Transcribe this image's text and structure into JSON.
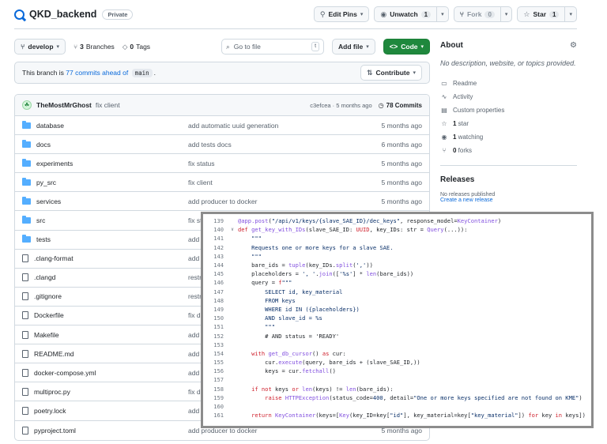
{
  "repo": {
    "name": "QKD_backend",
    "visibility": "Private",
    "actions": {
      "edit_pins": "Edit Pins",
      "unwatch": "Unwatch",
      "unwatch_count": "1",
      "fork": "Fork",
      "fork_count": "0",
      "star": "Star",
      "star_count": "1"
    }
  },
  "toolbar": {
    "branch": "develop",
    "branches_count": "3",
    "branches_label": "Branches",
    "tags_count": "0",
    "tags_label": "Tags",
    "search_placeholder": "Go to file",
    "search_kbd": "t",
    "add_file": "Add file",
    "code": "Code"
  },
  "ahead": {
    "prefix": "This branch is",
    "link": "77 commits ahead of",
    "base": "main",
    "suffix": ".",
    "contribute": "Contribute"
  },
  "last_commit": {
    "author": "TheMostMrGhost",
    "message": "fix client",
    "meta": "c3efcea · 5 months ago",
    "commits": "78 Commits"
  },
  "files": [
    {
      "name": "database",
      "type": "dir",
      "message": "add automatic uuid generation",
      "date": "5 months ago"
    },
    {
      "name": "docs",
      "type": "dir",
      "message": "add tests docs",
      "date": "6 months ago"
    },
    {
      "name": "experiments",
      "type": "dir",
      "message": "fix status",
      "date": "5 months ago"
    },
    {
      "name": "py_src",
      "type": "dir",
      "message": "fix client",
      "date": "5 months ago"
    },
    {
      "name": "services",
      "type": "dir",
      "message": "add producer to docker",
      "date": "5 months ago"
    },
    {
      "name": "src",
      "type": "dir",
      "message": "fix st",
      "date": ""
    },
    {
      "name": "tests",
      "type": "dir",
      "message": "add t",
      "date": ""
    },
    {
      "name": ".clang-format",
      "type": "file",
      "message": "add a",
      "date": ""
    },
    {
      "name": ".clangd",
      "type": "file",
      "message": "restr",
      "date": ""
    },
    {
      "name": ".gitignore",
      "type": "file",
      "message": "restr",
      "date": ""
    },
    {
      "name": "Dockerfile",
      "type": "file",
      "message": "fix de",
      "date": ""
    },
    {
      "name": "Makefile",
      "type": "file",
      "message": "add p",
      "date": ""
    },
    {
      "name": "README.md",
      "type": "file",
      "message": "add p",
      "date": ""
    },
    {
      "name": "docker-compose.yml",
      "type": "file",
      "message": "add p",
      "date": ""
    },
    {
      "name": "multiproc.py",
      "type": "file",
      "message": "fix de",
      "date": ""
    },
    {
      "name": "poetry.lock",
      "type": "file",
      "message": "add p",
      "date": ""
    },
    {
      "name": "pyproject.toml",
      "type": "file",
      "message": "add producer to docker",
      "date": "5 months ago"
    }
  ],
  "about": {
    "title": "About",
    "description": "No description, website, or topics provided.",
    "items": [
      {
        "icon": "book-icon",
        "glyph": "▭",
        "label": "Readme",
        "bold": ""
      },
      {
        "icon": "pulse-icon",
        "glyph": "∿",
        "label": "Activity",
        "bold": ""
      },
      {
        "icon": "note-icon",
        "glyph": "▤",
        "label": "Custom properties",
        "bold": ""
      },
      {
        "icon": "star-icon",
        "glyph": "☆",
        "label": " star",
        "bold": "1"
      },
      {
        "icon": "eye-icon",
        "glyph": "◉",
        "label": " watching",
        "bold": "1"
      },
      {
        "icon": "fork-icon",
        "glyph": "⑂",
        "label": " forks",
        "bold": "0"
      }
    ]
  },
  "releases": {
    "title": "Releases",
    "none": "No releases published",
    "create": "Create a new release"
  },
  "code": {
    "lines": [
      {
        "n": "139",
        "fold": "",
        "html": "<span class='fn'>@app.post</span>(<span class='st'>\"/api/v1/keys/{slave_SAE_ID}/dec_keys\"</span>, response_model=<span class='fn'>KeyContainer</span>)"
      },
      {
        "n": "140",
        "fold": "∨",
        "html": "<span class='kw'>def</span> <span class='fn'>get_key_with_IDs</span>(slave_SAE_ID: <span class='kw'>UUID</span>, key_IDs: str = <span class='fn'>Query</span>(...)):"
      },
      {
        "n": "141",
        "fold": "",
        "html": "    <span class='st'>\"\"\"</span>"
      },
      {
        "n": "142",
        "fold": "",
        "html": "    <span class='st'>Requests one or more keys for a slave SAE.</span>"
      },
      {
        "n": "143",
        "fold": "",
        "html": "    <span class='st'>\"\"\"</span>"
      },
      {
        "n": "144",
        "fold": "",
        "html": "    bare_ids = <span class='fn'>tuple</span>(key_IDs.<span class='fn'>split</span>(<span class='st'>','</span>))"
      },
      {
        "n": "145",
        "fold": "",
        "html": "    placeholders = <span class='st'>', '</span>.<span class='fn'>join</span>([<span class='st'>'%s'</span>] * <span class='fn'>len</span>(bare_ids))"
      },
      {
        "n": "146",
        "fold": "",
        "html": "    query = <span class='kw'>f</span><span class='st'>\"\"\"</span>"
      },
      {
        "n": "147",
        "fold": "",
        "html": "<span class='st'>        SELECT id, key_material</span>"
      },
      {
        "n": "148",
        "fold": "",
        "html": "<span class='st'>        FROM keys</span>"
      },
      {
        "n": "149",
        "fold": "",
        "html": "<span class='st'>        WHERE id IN ({placeholders})</span>"
      },
      {
        "n": "150",
        "fold": "",
        "html": "<span class='st'>        AND slave_id = %s</span>"
      },
      {
        "n": "151",
        "fold": "",
        "html": "<span class='st'>        \"\"\"</span>"
      },
      {
        "n": "152",
        "fold": "",
        "html": "<span class='cm'>        # AND status = 'READY'</span>"
      },
      {
        "n": "153",
        "fold": "",
        "html": ""
      },
      {
        "n": "154",
        "fold": "",
        "html": "    <span class='kw'>with</span> <span class='fn'>get_db_cursor</span>() <span class='kw'>as</span> cur:"
      },
      {
        "n": "155",
        "fold": "",
        "html": "        cur.<span class='fn'>execute</span>(query, bare_ids + (slave_SAE_ID,))"
      },
      {
        "n": "156",
        "fold": "",
        "html": "        keys = cur.<span class='fn'>fetchall</span>()"
      },
      {
        "n": "157",
        "fold": "",
        "html": ""
      },
      {
        "n": "158",
        "fold": "",
        "html": "    <span class='kw'>if not</span> keys <span class='kw'>or</span> <span class='fn'>len</span>(keys) != <span class='fn'>len</span>(bare_ids):"
      },
      {
        "n": "159",
        "fold": "",
        "html": "        <span class='kw'>raise</span> <span class='fn'>HTTPException</span>(status_code=<span class='st'>400</span>, detail=<span class='st'>\"One or more keys specified are not found on KME\"</span>)"
      },
      {
        "n": "160",
        "fold": "",
        "html": ""
      },
      {
        "n": "161",
        "fold": "",
        "html": "    <span class='kw'>return</span> <span class='fn'>KeyContainer</span>(keys=[<span class='fn'>Key</span>(key_ID=key[<span class='st'>\"id\"</span>], key_material=key[<span class='st'>\"key_material\"</span>]) <span class='kw'>for</span> key <span class='kw'>in</span> keys])"
      }
    ]
  }
}
